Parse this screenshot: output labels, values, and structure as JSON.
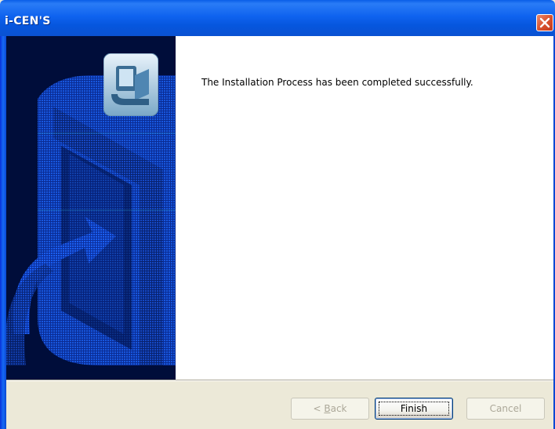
{
  "window": {
    "title": "i-CEN'S"
  },
  "content": {
    "message": "The Installation Process has been completed successfully."
  },
  "buttons": {
    "back_mnemonic": "B",
    "back_rest": "ack",
    "back_prefix": "< ",
    "finish_label": "Finish",
    "cancel_label": "Cancel"
  },
  "icons": {
    "close": "close-icon",
    "installer": "installer-computer-icon"
  },
  "colors": {
    "titlebar": "#0a5ee8",
    "sidebar": "#000d3a",
    "sidebar_art": "#1a56e0",
    "dialog_bg": "#ece9d8"
  }
}
